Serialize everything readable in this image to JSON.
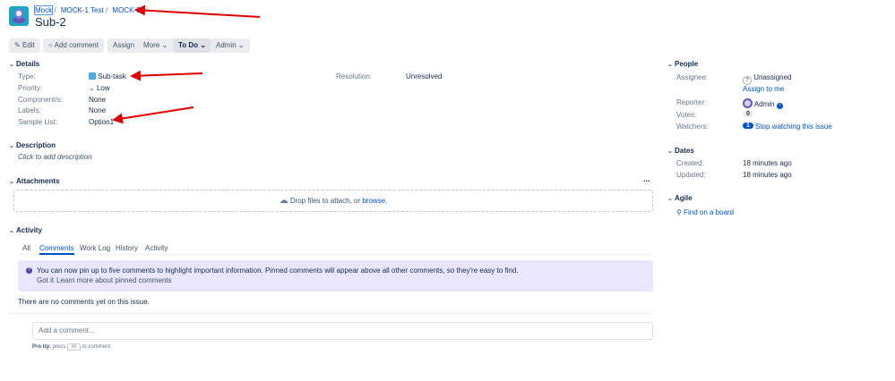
{
  "breadcrumb": [
    "Mock",
    "MOCK-1 Test",
    "MOCK-3"
  ],
  "title": "Sub-2",
  "toolbar": {
    "edit": "Edit",
    "add_comment": "Add comment",
    "assign": "Assign",
    "more": "More",
    "status": "To Do",
    "admin": "Admin"
  },
  "details": {
    "heading": "Details",
    "fields": [
      {
        "label": "Type:",
        "value": "Sub-task"
      },
      {
        "label": "Priority:",
        "value": "Low"
      },
      {
        "label": "Component/s:",
        "value": "None"
      },
      {
        "label": "Labels:",
        "value": "None"
      },
      {
        "label": "Sample List:",
        "value": "Option1"
      }
    ],
    "resolution_label": "Resolution:",
    "resolution_value": "Unresolved"
  },
  "description": {
    "heading": "Description",
    "placeholder": "Click to add description"
  },
  "attachments": {
    "heading": "Attachments",
    "more": "...",
    "drop_text": "Drop files to attach, or ",
    "browse": "browse."
  },
  "activity": {
    "heading": "Activity",
    "tabs": [
      "All",
      "Comments",
      "Work Log",
      "History",
      "Activity"
    ],
    "banner": "You can now pin up to five comments to highlight important information. Pinned comments will appear above all other comments, so they're easy to find.",
    "got_it": "Got it",
    "learn_more": "Learn more about pinned comments",
    "empty": "There are no comments yet on this issue.",
    "comment_placeholder": "Add a comment...",
    "pro_tip": "Pro tip:",
    "press": "press",
    "key": "m",
    "to_comment": "to comment"
  },
  "people": {
    "heading": "People",
    "assignee_label": "Assignee:",
    "assignee": "Unassigned",
    "assign_to_me": "Assign to me",
    "reporter_label": "Reporter:",
    "reporter": "Admin",
    "votes_label": "Votes:",
    "votes": "0",
    "watchers_label": "Watchers:",
    "watchers": "1",
    "stop_watching": "Stop watching this issue"
  },
  "dates": {
    "heading": "Dates",
    "created_label": "Created:",
    "created": "18 minutes ago",
    "updated_label": "Updated:",
    "updated": "18 minutes ago"
  },
  "agile": {
    "heading": "Agile",
    "find": "Find on a board"
  },
  "colors": {
    "link": "#0052cc",
    "banner": "#eae6ff",
    "annotation": "#e00000"
  }
}
